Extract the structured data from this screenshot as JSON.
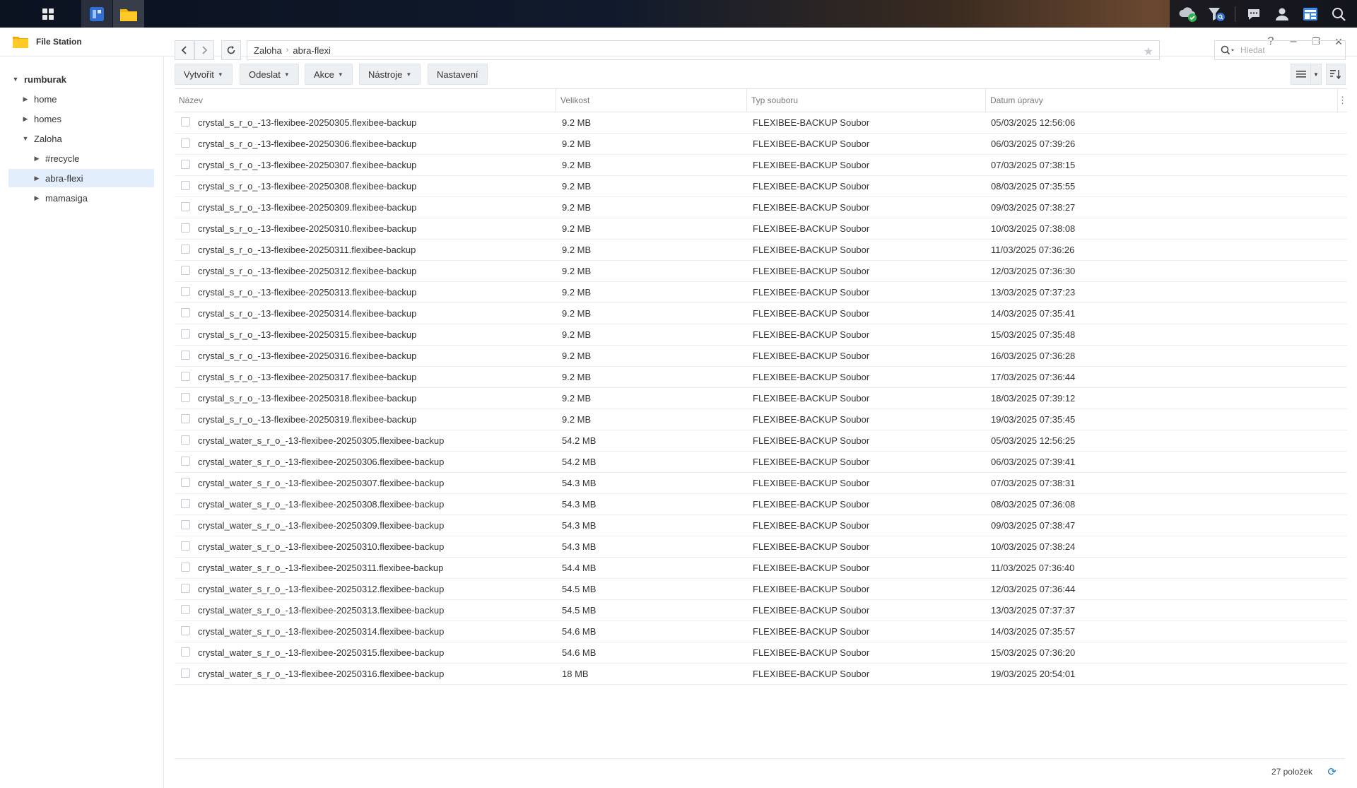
{
  "window": {
    "title": "File Station",
    "help": "?",
    "minimize": "–",
    "restore": "❐",
    "close": "✕"
  },
  "sidebar": {
    "root": "rumburak",
    "items": [
      {
        "label": "home",
        "caret": "▶"
      },
      {
        "label": "homes",
        "caret": "▶"
      },
      {
        "label": "Zaloha",
        "caret": "▼"
      },
      {
        "label": "#recycle",
        "caret": "▶"
      },
      {
        "label": "abra-flexi",
        "caret": "▶"
      },
      {
        "label": "mamasiga",
        "caret": "▶"
      }
    ]
  },
  "path": {
    "segments": [
      "Zaloha",
      "abra-flexi"
    ]
  },
  "search": {
    "placeholder": "Hledat"
  },
  "toolbar": {
    "create": "Vytvořit",
    "send": "Odeslat",
    "action": "Akce",
    "tools": "Nástroje",
    "settings": "Nastavení"
  },
  "table": {
    "headers": [
      "Název",
      "Velikost",
      "Typ souboru",
      "Datum úpravy"
    ],
    "rows": [
      [
        "crystal_s_r_o_-13-flexibee-20250305.flexibee-backup",
        "9.2 MB",
        "FLEXIBEE-BACKUP Soubor",
        "05/03/2025 12:56:06"
      ],
      [
        "crystal_s_r_o_-13-flexibee-20250306.flexibee-backup",
        "9.2 MB",
        "FLEXIBEE-BACKUP Soubor",
        "06/03/2025 07:39:26"
      ],
      [
        "crystal_s_r_o_-13-flexibee-20250307.flexibee-backup",
        "9.2 MB",
        "FLEXIBEE-BACKUP Soubor",
        "07/03/2025 07:38:15"
      ],
      [
        "crystal_s_r_o_-13-flexibee-20250308.flexibee-backup",
        "9.2 MB",
        "FLEXIBEE-BACKUP Soubor",
        "08/03/2025 07:35:55"
      ],
      [
        "crystal_s_r_o_-13-flexibee-20250309.flexibee-backup",
        "9.2 MB",
        "FLEXIBEE-BACKUP Soubor",
        "09/03/2025 07:38:27"
      ],
      [
        "crystal_s_r_o_-13-flexibee-20250310.flexibee-backup",
        "9.2 MB",
        "FLEXIBEE-BACKUP Soubor",
        "10/03/2025 07:38:08"
      ],
      [
        "crystal_s_r_o_-13-flexibee-20250311.flexibee-backup",
        "9.2 MB",
        "FLEXIBEE-BACKUP Soubor",
        "11/03/2025 07:36:26"
      ],
      [
        "crystal_s_r_o_-13-flexibee-20250312.flexibee-backup",
        "9.2 MB",
        "FLEXIBEE-BACKUP Soubor",
        "12/03/2025 07:36:30"
      ],
      [
        "crystal_s_r_o_-13-flexibee-20250313.flexibee-backup",
        "9.2 MB",
        "FLEXIBEE-BACKUP Soubor",
        "13/03/2025 07:37:23"
      ],
      [
        "crystal_s_r_o_-13-flexibee-20250314.flexibee-backup",
        "9.2 MB",
        "FLEXIBEE-BACKUP Soubor",
        "14/03/2025 07:35:41"
      ],
      [
        "crystal_s_r_o_-13-flexibee-20250315.flexibee-backup",
        "9.2 MB",
        "FLEXIBEE-BACKUP Soubor",
        "15/03/2025 07:35:48"
      ],
      [
        "crystal_s_r_o_-13-flexibee-20250316.flexibee-backup",
        "9.2 MB",
        "FLEXIBEE-BACKUP Soubor",
        "16/03/2025 07:36:28"
      ],
      [
        "crystal_s_r_o_-13-flexibee-20250317.flexibee-backup",
        "9.2 MB",
        "FLEXIBEE-BACKUP Soubor",
        "17/03/2025 07:36:44"
      ],
      [
        "crystal_s_r_o_-13-flexibee-20250318.flexibee-backup",
        "9.2 MB",
        "FLEXIBEE-BACKUP Soubor",
        "18/03/2025 07:39:12"
      ],
      [
        "crystal_s_r_o_-13-flexibee-20250319.flexibee-backup",
        "9.2 MB",
        "FLEXIBEE-BACKUP Soubor",
        "19/03/2025 07:35:45"
      ],
      [
        "crystal_water_s_r_o_-13-flexibee-20250305.flexibee-backup",
        "54.2 MB",
        "FLEXIBEE-BACKUP Soubor",
        "05/03/2025 12:56:25"
      ],
      [
        "crystal_water_s_r_o_-13-flexibee-20250306.flexibee-backup",
        "54.2 MB",
        "FLEXIBEE-BACKUP Soubor",
        "06/03/2025 07:39:41"
      ],
      [
        "crystal_water_s_r_o_-13-flexibee-20250307.flexibee-backup",
        "54.3 MB",
        "FLEXIBEE-BACKUP Soubor",
        "07/03/2025 07:38:31"
      ],
      [
        "crystal_water_s_r_o_-13-flexibee-20250308.flexibee-backup",
        "54.3 MB",
        "FLEXIBEE-BACKUP Soubor",
        "08/03/2025 07:36:08"
      ],
      [
        "crystal_water_s_r_o_-13-flexibee-20250309.flexibee-backup",
        "54.3 MB",
        "FLEXIBEE-BACKUP Soubor",
        "09/03/2025 07:38:47"
      ],
      [
        "crystal_water_s_r_o_-13-flexibee-20250310.flexibee-backup",
        "54.3 MB",
        "FLEXIBEE-BACKUP Soubor",
        "10/03/2025 07:38:24"
      ],
      [
        "crystal_water_s_r_o_-13-flexibee-20250311.flexibee-backup",
        "54.4 MB",
        "FLEXIBEE-BACKUP Soubor",
        "11/03/2025 07:36:40"
      ],
      [
        "crystal_water_s_r_o_-13-flexibee-20250312.flexibee-backup",
        "54.5 MB",
        "FLEXIBEE-BACKUP Soubor",
        "12/03/2025 07:36:44"
      ],
      [
        "crystal_water_s_r_o_-13-flexibee-20250313.flexibee-backup",
        "54.5 MB",
        "FLEXIBEE-BACKUP Soubor",
        "13/03/2025 07:37:37"
      ],
      [
        "crystal_water_s_r_o_-13-flexibee-20250314.flexibee-backup",
        "54.6 MB",
        "FLEXIBEE-BACKUP Soubor",
        "14/03/2025 07:35:57"
      ],
      [
        "crystal_water_s_r_o_-13-flexibee-20250315.flexibee-backup",
        "54.6 MB",
        "FLEXIBEE-BACKUP Soubor",
        "15/03/2025 07:36:20"
      ],
      [
        "crystal_water_s_r_o_-13-flexibee-20250316.flexibee-backup",
        "18 MB",
        "FLEXIBEE-BACKUP Soubor",
        "19/03/2025 20:54:01"
      ]
    ]
  },
  "status": {
    "count": "27 položek"
  },
  "colors": {
    "accent": "#1a7ad4",
    "folder": "#f5b800",
    "selection": "#e2eefb"
  },
  "icons": [
    "apps-grid-icon",
    "app-launcher-icon",
    "folder-icon",
    "cloud-sync-icon",
    "search-drive-icon",
    "chat-icon",
    "user-icon",
    "widgets-icon",
    "search-icon",
    "back-icon",
    "forward-icon",
    "refresh-icon",
    "star-icon",
    "list-view-icon",
    "sort-icon"
  ]
}
